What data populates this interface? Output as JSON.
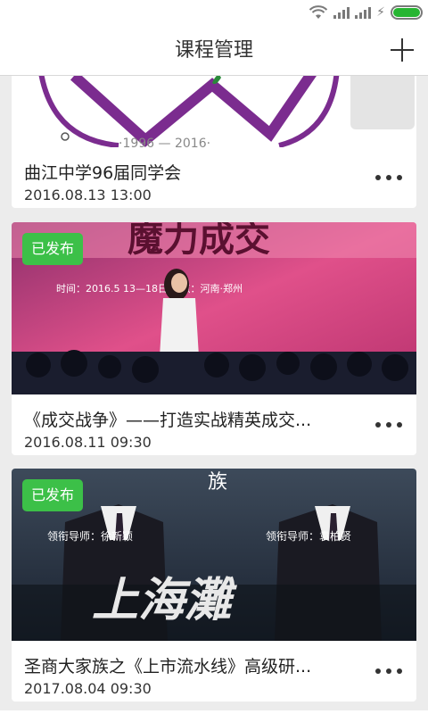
{
  "header": {
    "title": "课程管理",
    "add_icon": "plus-icon"
  },
  "courses": [
    {
      "title": "曲江中学96届同学会",
      "date": "2016.08.13 13:00",
      "badge": "",
      "image": "purple-logo-banner"
    },
    {
      "title": "《成交战争》——打造实战精英成交...",
      "date": "2016.08.11 09:30",
      "badge": "已发布",
      "image": "stage-speaker-banner"
    },
    {
      "title": "圣商大家族之《上市流水线》高级研...",
      "date": "2017.08.04 09:30",
      "badge": "已发布",
      "image": "shanghai-tan-poster"
    }
  ],
  "poster2": {
    "line1": "魔力成交",
    "line2": "时间：2016.5  13—18日    地点：河南·郑州"
  },
  "poster3": {
    "top_text": "族",
    "left_caption": "领衔导师：徐新颖",
    "right_caption": "领衔导师：袁柏贤",
    "title": "上海灘"
  },
  "colors": {
    "badge": "#3cc048",
    "accent_purple": "#7b2c8f"
  }
}
